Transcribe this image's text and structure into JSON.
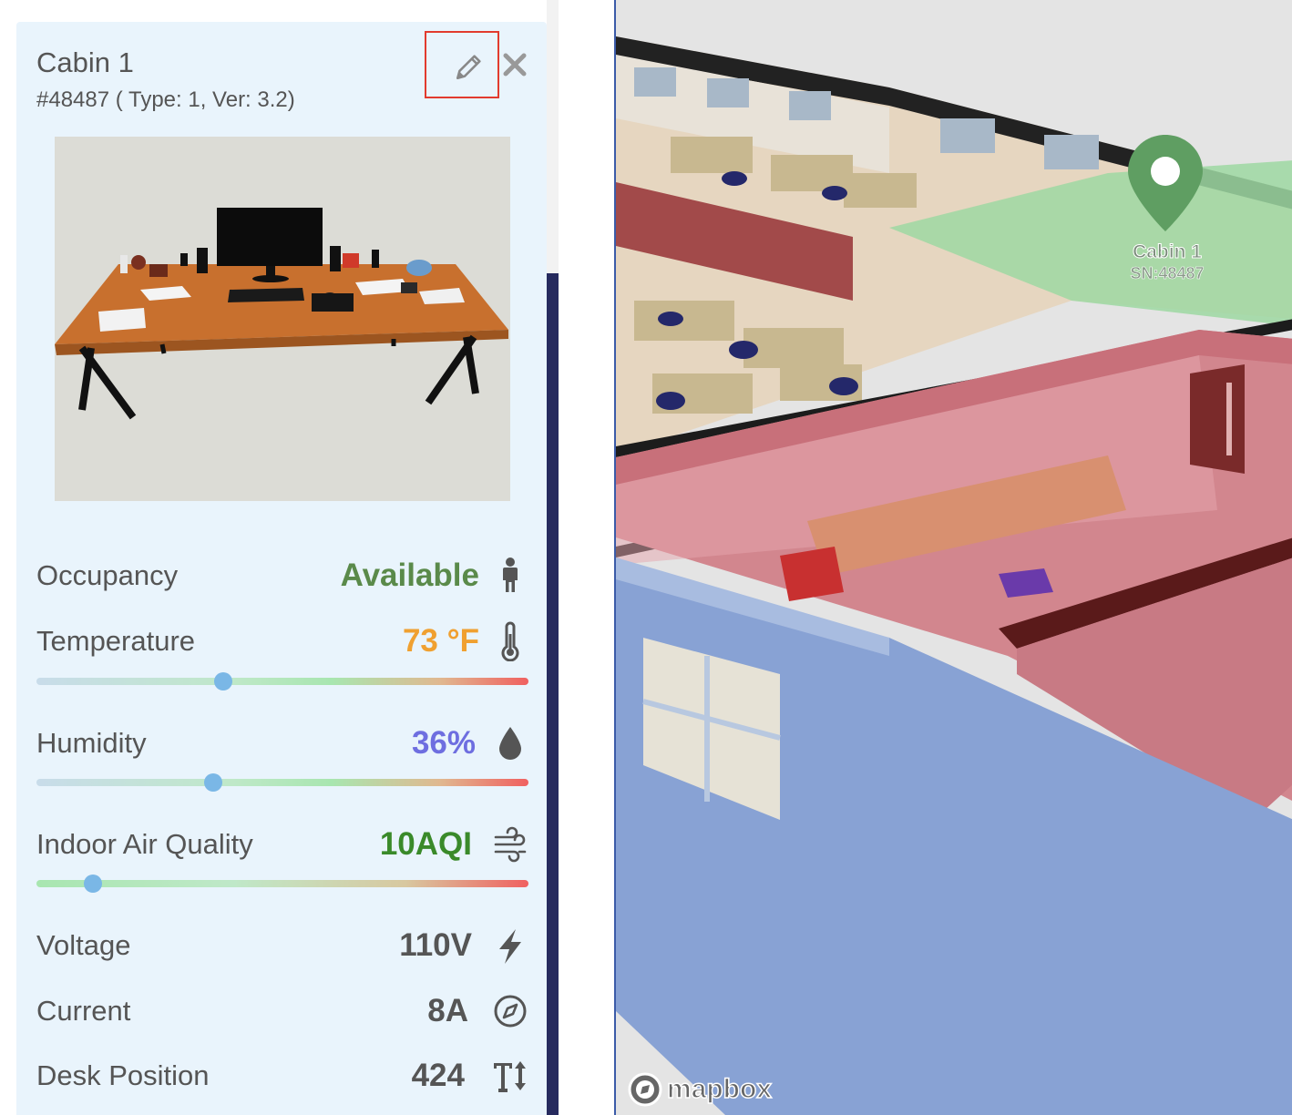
{
  "panel": {
    "title": "Cabin 1",
    "subtitle": "#48487 ( Type: 1, Ver: 3.2)",
    "occupancy": {
      "label": "Occupancy",
      "value": "Available",
      "color": "#5a8a4a"
    },
    "temperature": {
      "label": "Temperature",
      "value": "73 °F",
      "color": "#f0a030",
      "level": 0.38
    },
    "humidity": {
      "label": "Humidity",
      "value": "36%",
      "color": "#6e6ee0",
      "level": 0.36
    },
    "air_quality": {
      "label": "Indoor Air Quality",
      "value": "10AQI",
      "color": "#3a8a2a",
      "level": 0.115
    },
    "voltage": {
      "label": "Voltage",
      "value": "110V"
    },
    "current": {
      "label": "Current",
      "value": "8A"
    },
    "desk_position": {
      "label": "Desk Position",
      "value": "424"
    }
  },
  "map": {
    "marker_label": "Cabin 1",
    "marker_sn": "SN:48487",
    "attribution": "mapbox"
  }
}
